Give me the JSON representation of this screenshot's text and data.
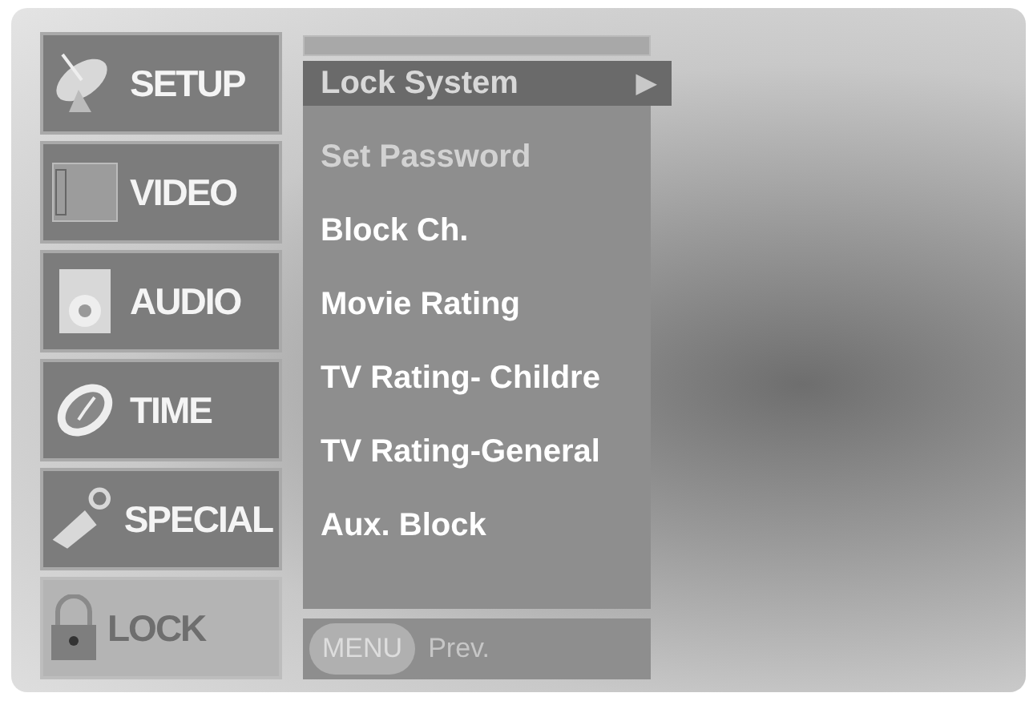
{
  "sidebar": {
    "items": [
      {
        "label": "SETUP",
        "selected": false
      },
      {
        "label": "VIDEO",
        "selected": false
      },
      {
        "label": "AUDIO",
        "selected": false
      },
      {
        "label": "TIME",
        "selected": false
      },
      {
        "label": "SPECIAL",
        "selected": false
      },
      {
        "label": "LOCK",
        "selected": true
      }
    ]
  },
  "submenu": {
    "items": [
      {
        "label": "Lock System",
        "arrow": "▶",
        "selected": true,
        "disabled": false
      },
      {
        "label": "Set Password",
        "selected": false,
        "disabled": true
      },
      {
        "label": "Block Ch.",
        "selected": false,
        "disabled": false
      },
      {
        "label": "Movie Rating",
        "selected": false,
        "disabled": false
      },
      {
        "label": "TV Rating- Childre",
        "selected": false,
        "disabled": false
      },
      {
        "label": "TV Rating-General",
        "selected": false,
        "disabled": false
      },
      {
        "label": "Aux. Block",
        "selected": false,
        "disabled": false
      }
    ]
  },
  "footer": {
    "key": "MENU",
    "hint": "Prev."
  }
}
